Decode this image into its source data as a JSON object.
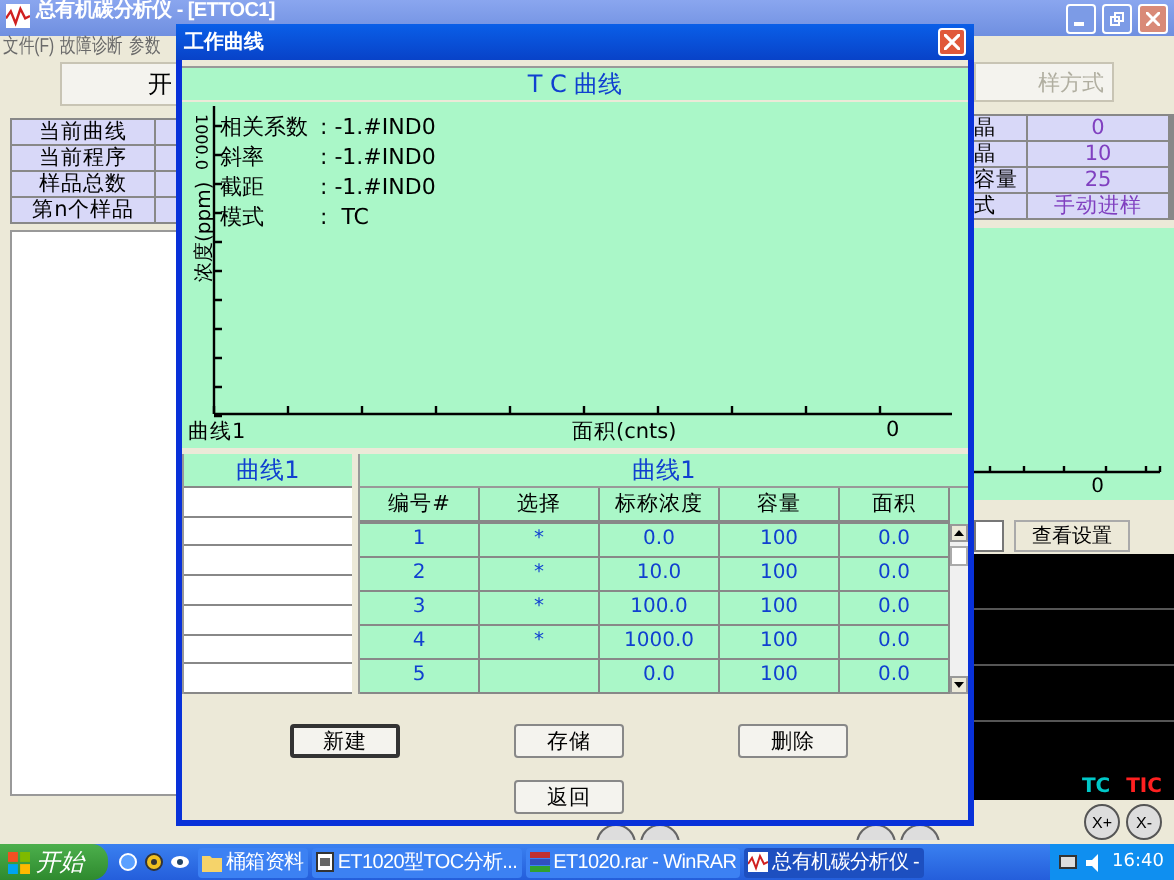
{
  "main_window": {
    "title": "总有机碳分析仪 - [ETTOC1]",
    "menu": [
      "文件(F)",
      "故障诊断",
      "参数"
    ],
    "left_button": "开",
    "left_table": [
      {
        "label": "当前曲线"
      },
      {
        "label": "当前程序"
      },
      {
        "label": "样品总数"
      },
      {
        "label": "第n个样品"
      }
    ],
    "right_button": "样方式",
    "right_table": [
      {
        "label": "晶",
        "value": "0"
      },
      {
        "label": "晶",
        "value": "10"
      },
      {
        "label": "容量",
        "value": "25"
      },
      {
        "label": "式",
        "value": "手动进样"
      }
    ],
    "right_chart": {
      "xtick": "0"
    },
    "view_settings_button": "查看设置",
    "signal_legend": [
      {
        "label": "TC",
        "color": "#00c8c8"
      },
      {
        "label": "TIC",
        "color": "#ff2020"
      }
    ],
    "zoom_buttons": [
      "X+",
      "X-"
    ]
  },
  "dialog": {
    "title": "工作曲线",
    "header": "T C 曲线",
    "chart": {
      "ylabel": "浓度(ppm)",
      "ytick": "1000.0",
      "series_label": "曲线1",
      "xlabel": "面积(cnts)",
      "xtick": "0",
      "stats": [
        {
          "label": "相关系数",
          "value": ": -1.#IND0"
        },
        {
          "label": "斜率",
          "value": ": -1.#IND0"
        },
        {
          "label": "截距",
          "value": ": -1.#IND0"
        },
        {
          "label": "模式",
          "value": ":  TC"
        }
      ]
    },
    "curve_list": {
      "header": "曲线1"
    },
    "table": {
      "title": "曲线1",
      "columns": [
        "编号#",
        "选择",
        "标称浓度",
        "容量",
        "面积"
      ],
      "rows": [
        {
          "cells": [
            "1",
            "*",
            "0.0",
            "100",
            "0.0"
          ]
        },
        {
          "cells": [
            "2",
            "*",
            "10.0",
            "100",
            "0.0"
          ]
        },
        {
          "cells": [
            "3",
            "*",
            "100.0",
            "100",
            "0.0"
          ]
        },
        {
          "cells": [
            "4",
            "*",
            "1000.0",
            "100",
            "0.0"
          ]
        },
        {
          "cells": [
            "5",
            "",
            "0.0",
            "100",
            "0.0"
          ]
        }
      ]
    },
    "buttons": [
      {
        "label": "新建",
        "default": true
      },
      {
        "label": "存储",
        "default": false
      },
      {
        "label": "删除",
        "default": false
      },
      {
        "label": "返回",
        "default": false
      }
    ]
  },
  "taskbar": {
    "start": "开始",
    "tasks": [
      {
        "label": "桶箱资料",
        "kind": "folder",
        "selected": false
      },
      {
        "label": "ET1020型TOC分析...",
        "kind": "document",
        "selected": false
      },
      {
        "label": "ET1020.rar - WinRAR",
        "kind": "archive",
        "selected": false
      },
      {
        "label": "总有机碳分析仪 -",
        "kind": "app",
        "selected": true
      }
    ],
    "clock": "16:40"
  }
}
